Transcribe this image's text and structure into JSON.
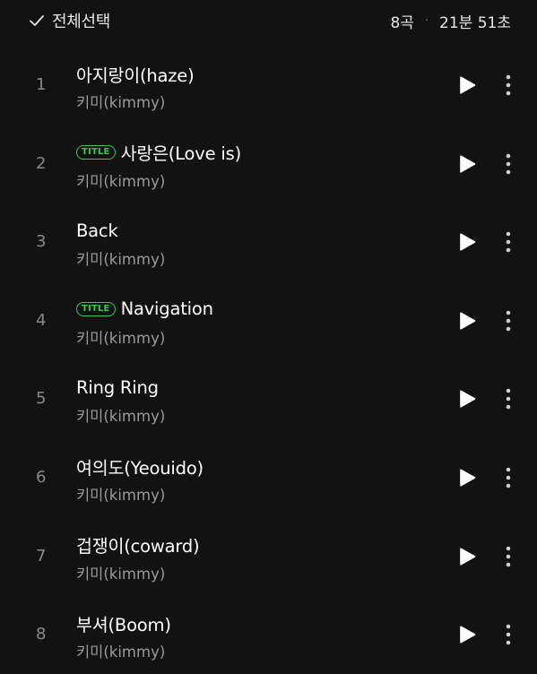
{
  "header": {
    "select_all_label": "전체선택",
    "track_count": "8곡",
    "separator": "·",
    "total_duration": "21분 51초"
  },
  "colors": {
    "background": "#121212",
    "accent_green": "#2ecc52",
    "primary_text": "#ffffff",
    "secondary_text": "#9a9a9a"
  },
  "tracks": [
    {
      "number": "1",
      "title": "아지랑이(haze)",
      "artist": "키미(kimmy)",
      "badge": ""
    },
    {
      "number": "2",
      "title": "사랑은(Love is)",
      "artist": "키미(kimmy)",
      "badge": "TITLE"
    },
    {
      "number": "3",
      "title": "Back",
      "artist": "키미(kimmy)",
      "badge": ""
    },
    {
      "number": "4",
      "title": "Navigation",
      "artist": "키미(kimmy)",
      "badge": "TITLE"
    },
    {
      "number": "5",
      "title": "Ring Ring",
      "artist": "키미(kimmy)",
      "badge": ""
    },
    {
      "number": "6",
      "title": "여의도(Yeouido)",
      "artist": "키미(kimmy)",
      "badge": ""
    },
    {
      "number": "7",
      "title": "겁쟁이(coward)",
      "artist": "키미(kimmy)",
      "badge": ""
    },
    {
      "number": "8",
      "title": "부셔(Boom)",
      "artist": "키미(kimmy)",
      "badge": ""
    }
  ],
  "icons": {
    "select_all": "check-icon",
    "play": "play-icon",
    "more": "more-vertical-icon"
  }
}
